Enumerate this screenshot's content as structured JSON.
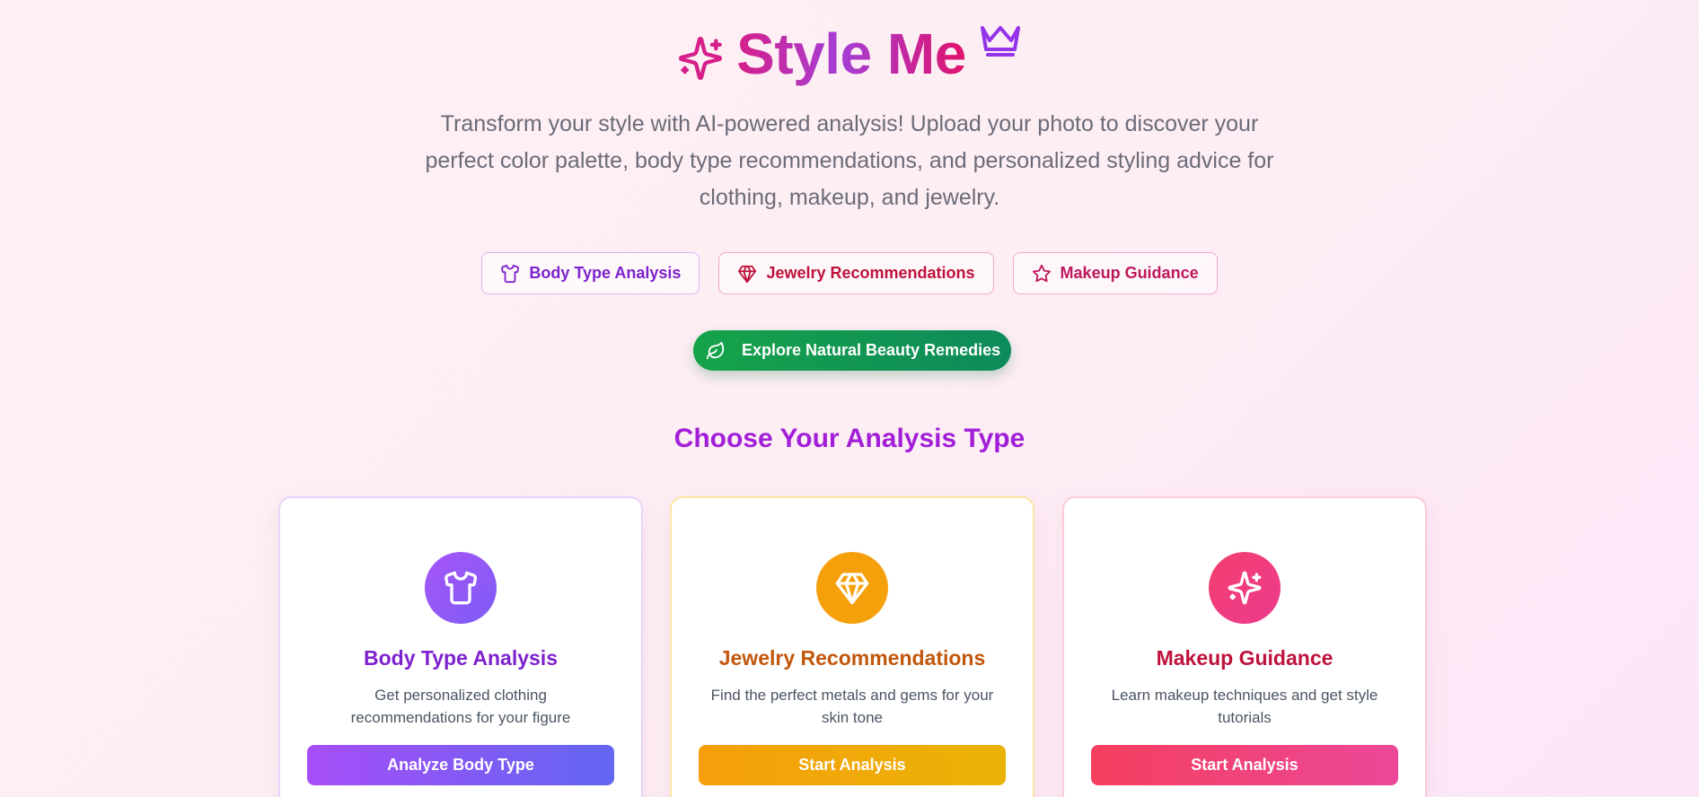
{
  "hero": {
    "title": "Style Me",
    "subtitle": "Transform your style with AI-powered analysis! Upload your photo to discover your perfect color palette, body type recommendations, and personalized styling advice for clothing, makeup, and jewelry."
  },
  "feature_pills": [
    {
      "label": "Body Type Analysis",
      "icon": "shirt-icon"
    },
    {
      "label": "Jewelry Recommendations",
      "icon": "gem-icon"
    },
    {
      "label": "Makeup Guidance",
      "icon": "star-icon"
    }
  ],
  "remedies_button": {
    "label": "Explore Natural Beauty Remedies",
    "icon": "leaf-icon"
  },
  "section": {
    "title": "Choose Your Analysis Type"
  },
  "cards": [
    {
      "title": "Body Type Analysis",
      "description": "Get personalized clothing recommendations for your figure",
      "button": "Analyze Body Type",
      "icon": "shirt-icon",
      "accent": "#7e22ce"
    },
    {
      "title": "Jewelry Recommendations",
      "description": "Find the perfect metals and gems for your skin tone",
      "button": "Start Analysis",
      "icon": "gem-icon",
      "accent": "#c2570c"
    },
    {
      "title": "Makeup Guidance",
      "description": "Learn makeup techniques and get style tutorials",
      "button": "Start Analysis",
      "icon": "sparkles-icon",
      "accent": "#be123c"
    }
  ]
}
